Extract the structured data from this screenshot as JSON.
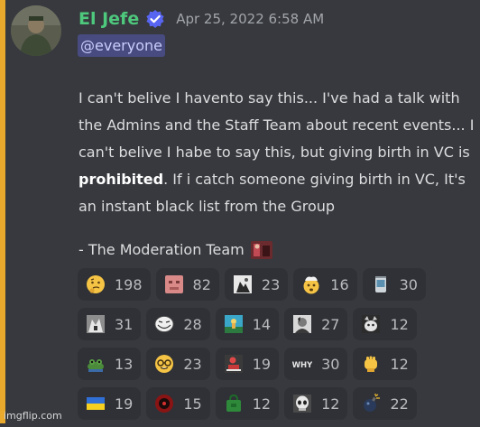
{
  "message": {
    "username": "El Jefe",
    "timestamp": "Apr 25, 2022 6:58 AM",
    "mention": "@everyone",
    "body_part1": "I can't belive I havento say this... I've had a talk with the Admins and the Staff Team about recent events... I can't belive I habe to say this, but giving birth in VC is ",
    "body_bold": "prohibited",
    "body_part2": ". If i catch someone giving birth in VC, It's an instant black list from the Group",
    "signoff": "- The Moderation Team"
  },
  "reactions": [
    [
      {
        "icon": "thinking-emoji",
        "count": "198"
      },
      {
        "icon": "pink-face-emoji",
        "count": "82"
      },
      {
        "icon": "photo-emoji",
        "count": "23"
      },
      {
        "icon": "exploding-head-emoji",
        "count": "16"
      },
      {
        "icon": "cup-emoji",
        "count": "30"
      }
    ],
    [
      {
        "icon": "gray-photo-emoji",
        "count": "31"
      },
      {
        "icon": "trollface-emoji",
        "count": "28"
      },
      {
        "icon": "landscape-emoji",
        "count": "14"
      },
      {
        "icon": "portrait-emoji",
        "count": "27"
      },
      {
        "icon": "cat-face-emoji",
        "count": "12"
      }
    ],
    [
      {
        "icon": "frog-emoji",
        "count": "13"
      },
      {
        "icon": "nerd-face-emoji",
        "count": "23"
      },
      {
        "icon": "red-figure-emoji",
        "count": "19"
      },
      {
        "icon": "why-text-emoji",
        "label": "WHY",
        "count": "30"
      },
      {
        "icon": "raised-fist-emoji",
        "count": "12"
      }
    ],
    [
      {
        "icon": "ukraine-flag-emoji",
        "count": "19"
      },
      {
        "icon": "red-orb-emoji",
        "count": "15"
      },
      {
        "icon": "green-bag-emoji",
        "count": "12"
      },
      {
        "icon": "skull-mask-emoji",
        "count": "12"
      },
      {
        "icon": "bomb-emoji",
        "count": "22"
      }
    ]
  ],
  "watermark": "imgflip.com"
}
